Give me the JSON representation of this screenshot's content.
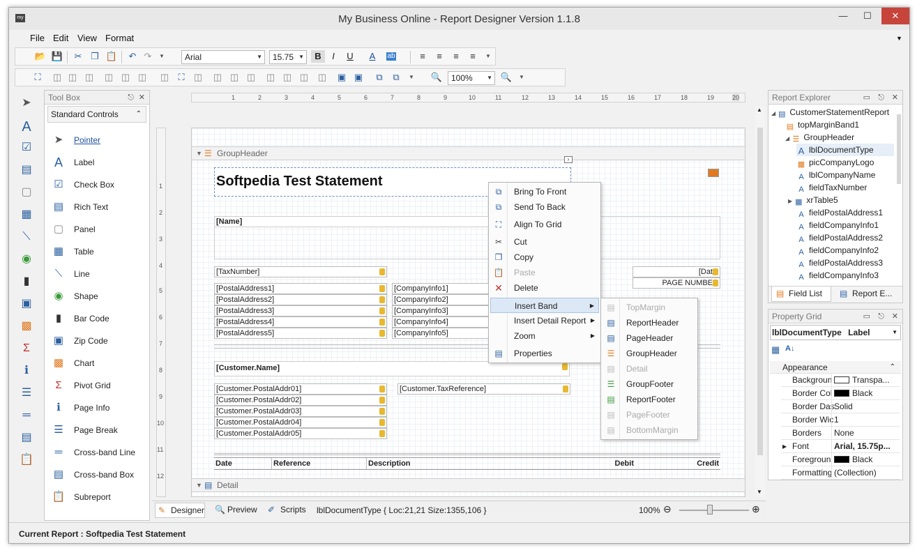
{
  "window": {
    "title": "My Business Online - Report Designer Version 1.1.8",
    "app_icon": "my"
  },
  "menu": [
    "File",
    "Edit",
    "View",
    "Format"
  ],
  "toolbar": {
    "font_family": "Arial",
    "font_size": "15.75",
    "zoom": "100%",
    "bold": "B",
    "italic": "I",
    "underline": "U"
  },
  "toolbox": {
    "title": "Tool Box",
    "group": "Standard Controls",
    "items": [
      "Pointer",
      "Label",
      "Check Box",
      "Rich Text",
      "Panel",
      "Table",
      "Line",
      "Shape",
      "Bar Code",
      "Zip Code",
      "Chart",
      "Pivot Grid",
      "Page Info",
      "Page Break",
      "Cross-band Line",
      "Cross-band Box",
      "Subreport"
    ]
  },
  "ruler": {
    "h": [
      "1",
      "2",
      "3",
      "4",
      "5",
      "6",
      "7",
      "8",
      "9",
      "10",
      "11",
      "12",
      "13",
      "14",
      "15",
      "16",
      "17",
      "18",
      "19",
      "20"
    ],
    "v": [
      "1",
      "2",
      "3",
      "4",
      "5",
      "6",
      "7",
      "8",
      "9",
      "10",
      "11",
      "12"
    ]
  },
  "design": {
    "band_groupheader": "GroupHeader",
    "band_detail": "Detail",
    "title": "Softpedia Test Statement",
    "name": "[Name]",
    "tax_number": "[TaxNumber]",
    "postal": [
      "[PostalAddress1]",
      "[PostalAddress2]",
      "[PostalAddress3]",
      "[PostalAddress4]",
      "[PostalAddress5]"
    ],
    "company": [
      "[CompanyInfo1]",
      "[CompanyInfo2]",
      "[CompanyInfo3]",
      "[CompanyInfo4]",
      "[CompanyInfo5]"
    ],
    "date_field": "[Dat",
    "page_number": "PAGE NUMBE",
    "customer_name": "[Customer.Name]",
    "cust_postal": [
      "[Customer.PostalAddr01]",
      "[Customer.PostalAddr02]",
      "[Customer.PostalAddr03]",
      "[Customer.PostalAddr04]",
      "[Customer.PostalAddr05]"
    ],
    "tax_reference": "[Customer.TaxReference]",
    "columns": [
      "Date",
      "Reference",
      "Description",
      "Debit",
      "Credit"
    ]
  },
  "context_menu": {
    "items": [
      "Bring To Front",
      "Send To Back",
      "Align To Grid",
      "Cut",
      "Copy",
      "Paste",
      "Delete",
      "Insert Band",
      "Insert Detail Report",
      "Zoom",
      "Properties"
    ]
  },
  "submenu": {
    "items": [
      "TopMargin",
      "ReportHeader",
      "PageHeader",
      "GroupHeader",
      "Detail",
      "GroupFooter",
      "ReportFooter",
      "PageFooter",
      "BottomMargin"
    ]
  },
  "explorer": {
    "title": "Report Explorer",
    "items": [
      "CustomerStatementReport",
      "topMarginBand1",
      "GroupHeader",
      "lblDocumentType",
      "picCompanyLogo",
      "lblCompanyName",
      "fieldTaxNumber",
      "xrTable5",
      "fieldPostalAddress1",
      "fieldCompanyInfo1",
      "fieldPostalAddress2",
      "fieldCompanyInfo2",
      "fieldPostalAddress3",
      "fieldCompanyInfo3"
    ],
    "tabs": [
      "Field List",
      "Report E..."
    ]
  },
  "property_grid": {
    "title": "Property Grid",
    "selected": "lblDocumentType",
    "selected_type": "Label",
    "category": "Appearance",
    "rows": [
      {
        "name": "Backgroun",
        "value": "Transpa..."
      },
      {
        "name": "Border Col",
        "value": "Black"
      },
      {
        "name": "Border Das",
        "value": "Solid"
      },
      {
        "name": "Border Wic",
        "value": "1"
      },
      {
        "name": "Borders",
        "value": "None"
      },
      {
        "name": "Font",
        "value": "Arial, 15.75p..."
      },
      {
        "name": "Foregroun",
        "value": "Black"
      },
      {
        "name": "Formatting",
        "value": "(Collection)"
      }
    ]
  },
  "tabs": {
    "designer": "Designer",
    "preview": "Preview",
    "scripts": "Scripts",
    "info": "lblDocumentType { Loc:21,21 Size:1355,106 }",
    "zoom": "100%"
  },
  "status": {
    "text": "Current Report : Softpedia Test Statement"
  },
  "colors": {
    "accent": "#2a5fa0",
    "close": "#c7443b",
    "selection": "#dce8f5"
  }
}
